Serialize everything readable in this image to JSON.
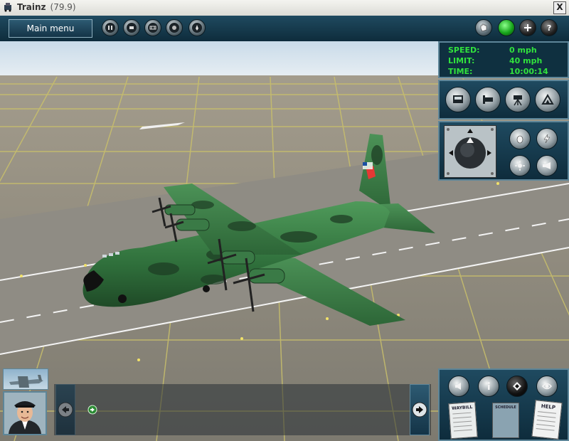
{
  "window": {
    "title": "Trainz",
    "version": "(79.9)",
    "close_label": "X"
  },
  "toolbar": {
    "main_menu_label": "Main menu",
    "left_buttons": [
      "pause-icon",
      "stop-icon",
      "film-icon",
      "record-icon",
      "speed-icon"
    ],
    "right_buttons": [
      "hand-icon",
      "green-light-icon",
      "plus-icon",
      "help-icon"
    ]
  },
  "readout": {
    "speed_label": "SPEED:",
    "speed_value": "0 mph",
    "limit_label": "LIMIT:",
    "limit_value": "40 mph",
    "time_label": "TIME:",
    "time_value": "10:00:14"
  },
  "camera_buttons": [
    "cab-view-icon",
    "external-view-icon",
    "tripod-camera-icon",
    "map-view-icon"
  ],
  "drive_buttons": [
    "hand-brake-icon",
    "lightning-icon",
    "light-icon",
    "horn-icon"
  ],
  "bottom_buttons": [
    "volume-icon",
    "info-icon",
    "compass-icon",
    "eye-icon"
  ],
  "papers": {
    "waybill_label": "WAYBILL",
    "schedule_label": "SCHEDULE",
    "help_label": "HELP"
  },
  "colors": {
    "panel": "#1f4a60",
    "readout_text": "#31e23d",
    "aircraft_green": "#3d8a4c"
  }
}
